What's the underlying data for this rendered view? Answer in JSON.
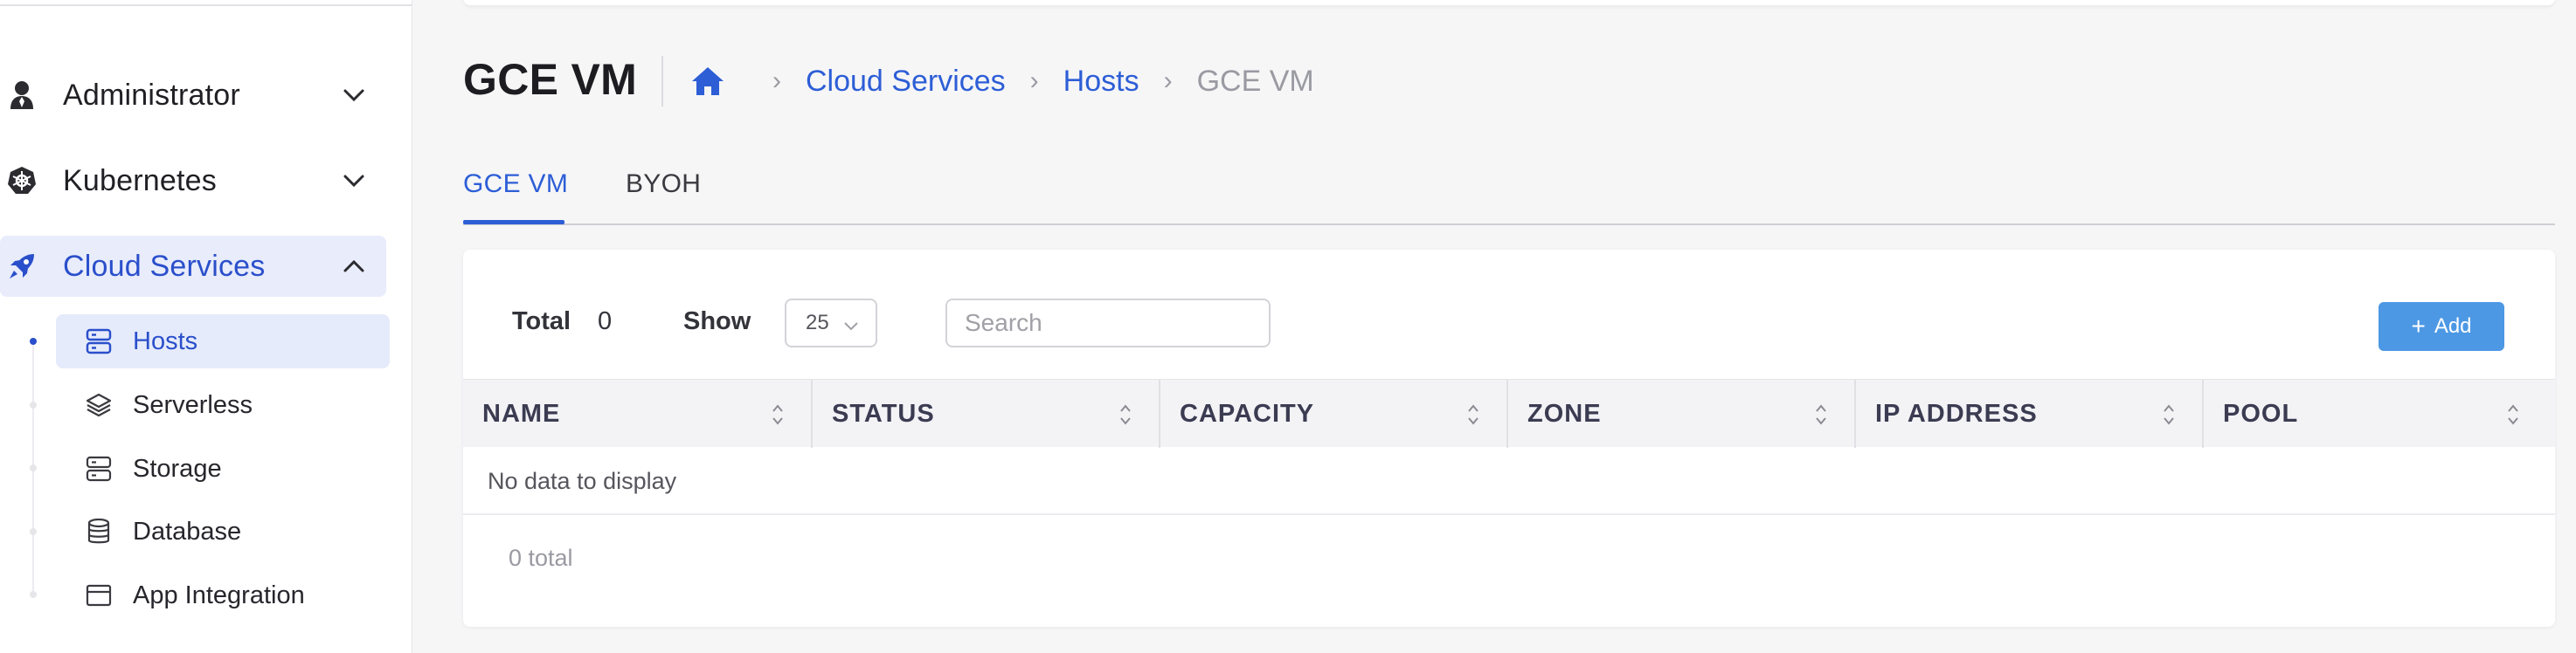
{
  "sidebar": {
    "groups": [
      {
        "label": "Administrator",
        "icon": "user-icon",
        "expanded": false
      },
      {
        "label": "Kubernetes",
        "icon": "kubernetes-icon",
        "expanded": false
      },
      {
        "label": "Cloud Services",
        "icon": "rocket-icon",
        "expanded": true
      }
    ],
    "items": [
      {
        "label": "Hosts",
        "icon": "server-icon",
        "active": true
      },
      {
        "label": "Serverless",
        "icon": "layers-icon",
        "active": false
      },
      {
        "label": "Storage",
        "icon": "server-icon",
        "active": false
      },
      {
        "label": "Database",
        "icon": "database-icon",
        "active": false
      },
      {
        "label": "App Integration",
        "icon": "window-icon",
        "active": false
      }
    ]
  },
  "header": {
    "title": "GCE VM",
    "breadcrumb": [
      "Cloud Services",
      "Hosts",
      "GCE VM"
    ]
  },
  "tabs": [
    {
      "label": "GCE VM",
      "active": true
    },
    {
      "label": "BYOH",
      "active": false
    }
  ],
  "toolbar": {
    "total_label": "Total",
    "total_value": "0",
    "show_label": "Show",
    "page_size": "25",
    "search_placeholder": "Search",
    "add_label": "Add"
  },
  "table": {
    "columns": [
      "NAME",
      "STATUS",
      "CAPACITY",
      "ZONE",
      "IP ADDRESS",
      "POOL"
    ],
    "empty_text": "No data to display",
    "footer_total": "0 total"
  },
  "colors": {
    "accent": "#2d5ed6",
    "active_bg": "#e8ecfb",
    "add_button": "#4c98e4"
  }
}
